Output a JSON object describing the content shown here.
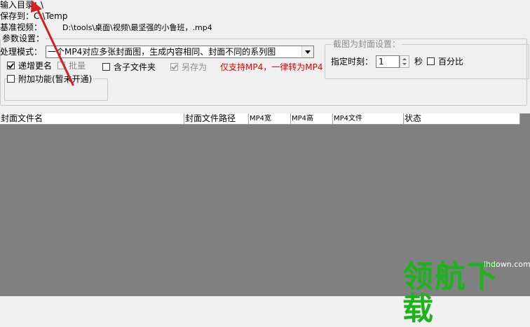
{
  "paths": {
    "input_label": "输入目录：",
    "input_value": "\\",
    "save_label": "保存到：",
    "save_value": "C:\\Temp",
    "target_label": "基准视频：",
    "target_value": "D:\\tools\\桌面\\视频\\最坚强的小鲁班，.mp4"
  },
  "params": {
    "group_title": "参数设置：",
    "mode_label": "处理模式：",
    "mode_value": "一个MP4对应多张封面图，生成内容相同、封面不同的系列图",
    "options": [
      {
        "label": "递增更名",
        "checked": true,
        "disabled": false
      },
      {
        "label": "批量",
        "checked": false,
        "disabled": true
      },
      {
        "label": "含子文件夹",
        "checked": false,
        "disabled": false
      },
      {
        "label": "另存为",
        "checked": true,
        "disabled": true
      }
    ],
    "notice": "仅支持MP4，一律转为MP4",
    "extra_label": "附加功能(暂未开通)"
  },
  "capture": {
    "group_title": "截图为封面设置：",
    "time_label": "指定时刻：",
    "time_value": "1",
    "unit_label": "秒",
    "percent_label": "百分比",
    "percent_checked": false
  },
  "table": {
    "columns": [
      "封面文件名",
      "封面文件路径",
      "MP4宽",
      "MP4高",
      "MP4文件",
      "状态"
    ]
  },
  "watermark": {
    "text": "领航下载",
    "site": "lhdown.com"
  },
  "colors": {
    "arrow": "#d42020",
    "notice": "#e00000",
    "grid_bg": "#808080",
    "watermark": "#1db31d"
  }
}
